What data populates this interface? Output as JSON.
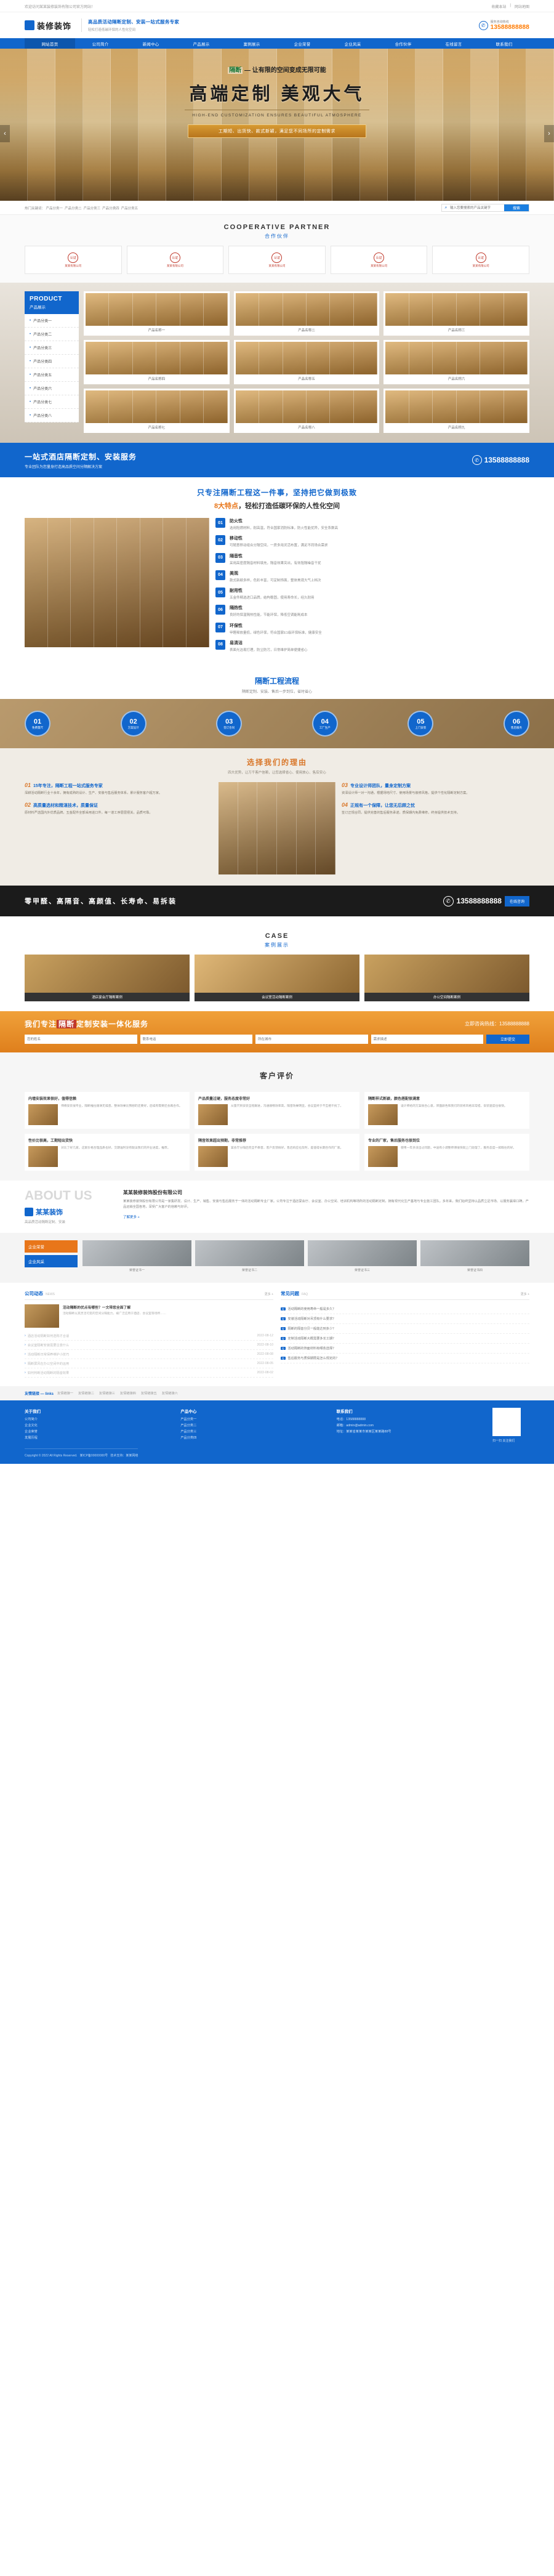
{
  "topbar": {
    "welcome": "欢迎访问某某装修装饰有限公司官方网站！",
    "links": [
      "收藏本站",
      "网站地图"
    ]
  },
  "header": {
    "logo_text": "装修装饰",
    "slogan_main": "高品质活动隔断定制、安装一站式服务专家",
    "slogan_sub": "轻松打造低碳环保的人性化空间",
    "phone_label": "服务咨询热线",
    "phone_number": "13588888888"
  },
  "nav": [
    {
      "label": "网站首页",
      "active": true
    },
    {
      "label": "公司简介",
      "active": false
    },
    {
      "label": "新闻中心",
      "active": false
    },
    {
      "label": "产品展示",
      "active": false
    },
    {
      "label": "案例展示",
      "active": false
    },
    {
      "label": "企业荣誉",
      "active": false
    },
    {
      "label": "企业风采",
      "active": false
    },
    {
      "label": "合作伙伴",
      "active": false
    },
    {
      "label": "在线留言",
      "active": false
    },
    {
      "label": "联系我们",
      "active": false
    }
  ],
  "banner": {
    "kicker_badge": "隔断",
    "kicker_text": "— 让有限的空间变成无限可能",
    "title": "高端定制  美观大气",
    "english": "HIGH-END CUSTOMIZATION ENSURES BEAUTIFUL ATMOSPHERE",
    "tags": "工期短、出货快、款式新颖，满足您不同场所的定制需求",
    "prev": "‹",
    "next": "›"
  },
  "search": {
    "hot_label": "热门关键词：",
    "hot_words": [
      "产品分类一",
      "产品分类二",
      "产品分类三",
      "产品分类四",
      "产品分类五"
    ],
    "placeholder": "输入您要搜索的产品关键字",
    "button": "搜索"
  },
  "partners": {
    "en": "COOPERATIVE PARTNER",
    "cn": "合作伙伴",
    "items": [
      {
        "name": "某某有限公司"
      },
      {
        "name": "某某有限公司"
      },
      {
        "name": "某某有限公司"
      },
      {
        "name": "某某有限公司"
      },
      {
        "name": "某某有限公司"
      }
    ]
  },
  "product": {
    "side_en": "PRODUCT",
    "side_cn": "产品展示",
    "categories": [
      "产品分类一",
      "产品分类二",
      "产品分类三",
      "产品分类四",
      "产品分类五",
      "产品分类六",
      "产品分类七",
      "产品分类八"
    ],
    "items": [
      {
        "name": "产品名称一"
      },
      {
        "name": "产品名称二"
      },
      {
        "name": "产品名称三"
      },
      {
        "name": "产品名称四"
      },
      {
        "name": "产品名称五"
      },
      {
        "name": "产品名称六"
      },
      {
        "name": "产品名称七"
      },
      {
        "name": "产品名称八"
      },
      {
        "name": "产品名称九"
      }
    ]
  },
  "cta_blue": {
    "title": "一站式酒店隔断定制、安装服务",
    "sub": "专业团队为您量身打造高品质空间分隔解决方案",
    "phone": "13588888888"
  },
  "features": {
    "h1": "只专注隔断工程这一件事，坚持把它做到极致",
    "h2_pre": "8大特点",
    "h2_post": "，轻松打造低碳环保的人性化空间",
    "items": [
      {
        "no": "01",
        "title": "防火性",
        "desc": "选用阻燃材料，耐高温，符合国家消防标准，防火性能优异，安全系数高"
      },
      {
        "no": "02",
        "title": "移动性",
        "desc": "可随意移动组合分隔空间，一房多用灵活布置，满足不同场合需求"
      },
      {
        "no": "03",
        "title": "隔音性",
        "desc": "采用高密度隔音材料填充，隔音效果突出，有效阻隔噪音干扰"
      },
      {
        "no": "04",
        "title": "美观",
        "desc": "款式新颖多样，色彩丰富，可定制饰面，整体美观大气上档次"
      },
      {
        "no": "05",
        "title": "耐用性",
        "desc": "五金件精选进口品牌，结构稳固，使用寿命长，经久耐用"
      },
      {
        "no": "06",
        "title": "隔热性",
        "desc": "良好的保温隔热性能，节能环保，降低空调能耗成本"
      },
      {
        "no": "07",
        "title": "环保性",
        "desc": "甲醛释放量低，绿色环保，符合国家E1级环保标准，健康安全"
      },
      {
        "no": "08",
        "title": "易清洁",
        "desc": "表面光洁易打理，防尘防污，日常维护简单便捷省心"
      }
    ]
  },
  "process": {
    "cn": "隔断工程流程",
    "sub": "隔断定制、安装、售后一步到位，省时省心",
    "steps": [
      {
        "no": "01",
        "label": "免费量尺"
      },
      {
        "no": "02",
        "label": "方案设计"
      },
      {
        "no": "03",
        "label": "签订合同"
      },
      {
        "no": "04",
        "label": "工厂生产"
      },
      {
        "no": "05",
        "label": "上门安装"
      },
      {
        "no": "06",
        "label": "售后服务"
      }
    ]
  },
  "why": {
    "cn": "选择我们的理由",
    "sub": "四大优势，让万千客户信赖，让您选择省心、使用放心、售后安心",
    "items": [
      {
        "no": "01",
        "title": "15年专注，隔断工程一站式服务专家",
        "desc": "深耕活动隔断行业十余年，拥有成熟的设计、生产、安装与售后服务体系，累计服务客户超万家。"
      },
      {
        "no": "02",
        "title": "高质量选材和精湛技术，质量保证",
        "desc": "原材料严选国内外优质品牌，五金配件全部采用进口件，每一道工序层层把关，品质可靠。"
      },
      {
        "no": "03",
        "title": "专业设计师团队，量身定制方案",
        "desc": "资深设计师一对一沟通，根据场地尺寸、使用场景与装修风格，提供个性化隔断定制方案。"
      },
      {
        "no": "04",
        "title": "正规有一个保障，让您无后顾之忧",
        "desc": "签订正规合同，提供完善的售后服务承诺，质保期内免费维修，终身提供技术支持。"
      }
    ]
  },
  "cta_dark": {
    "words": "零甲醛、高隔音、高颜值、长寿命、易拆装",
    "phone": "13588888888",
    "button": "在线咨询"
  },
  "case": {
    "en": "CASE",
    "cn": "案例展示",
    "items": [
      {
        "caption": "酒店宴会厅隔断案例"
      },
      {
        "caption": "会议室活动隔断案例"
      },
      {
        "caption": "办公空间隔断案例"
      }
    ]
  },
  "cta_orange": {
    "title_pre": "我们专注",
    "title_badge": "隔断",
    "title_post": "定制安装一体化服务",
    "phone_label": "立即咨询热线：",
    "phone": "13588888888",
    "fields": [
      {
        "placeholder": "您的姓名"
      },
      {
        "placeholder": "联系电话"
      },
      {
        "placeholder": "所在城市"
      },
      {
        "placeholder": "需求描述"
      }
    ],
    "submit": "立即提交"
  },
  "reviews": {
    "title": "客户评价",
    "items": [
      {
        "title": "内墙安装效果很好，值得信赖",
        "desc": "师傅安装很专业，隔断推拉顺滑无噪音，整体效果比预想的还要好，后续有需要还会再合作。"
      },
      {
        "title": "产品质量过硬，服务态度非常好",
        "desc": "从量尺到安装全程跟进，沟通顺畅效率高，隔音效果明显，会议室终于不互相干扰了。"
      },
      {
        "title": "隔断样式新颖，颜色搭配很满意",
        "desc": "设计师给的方案很合心意，饰面颜色和我们的装修风格非常搭，安装速度也很快。"
      },
      {
        "title": "性价比很高，工期短出货快",
        "desc": "对比了好几家，这家价格合理品质也好，交期准时没有耽误我们的开业进度，推荐。"
      },
      {
        "title": "隔音效果超出预期，非常推荐",
        "desc": "宴会厅分隔后完全不串音，客户反馈很好，售后响应也及时，是值得长期合作的厂家。"
      },
      {
        "title": "专业的厂家，售后服务也很到位",
        "desc": "使用一年多没出过问题，中途有小调整师傅很快就上门处理了，服务态度一如既往的好。"
      }
    ]
  },
  "about": {
    "big_en": "ABOUT US",
    "logo_name": "某某装饰",
    "logo_sub": "高品质活动隔断定制、安装",
    "heading": "某某装修装饰股份有限公司",
    "body": "某某装修装饰股份有限公司是一家集研发、设计、生产、销售、安装与售后服务于一体的活动隔断专业厂家。公司专注于酒店宴会厅、会议室、办公空间、培训机构等场所的活动隔断定制，拥有现代化生产基地与专业施工团队。多年来，我们始终坚持以品质立足市场、以服务赢得口碑，产品远销全国各地，深受广大客户的信赖与好评。",
    "more": "了解更多 +"
  },
  "showcase": {
    "tabs": [
      {
        "label": "企业荣誉"
      },
      {
        "label": "企业风采"
      }
    ],
    "items": [
      {
        "caption": "荣誉证书一"
      },
      {
        "caption": "荣誉证书二"
      },
      {
        "caption": "荣誉证书三"
      },
      {
        "caption": "荣誉证书四"
      }
    ]
  },
  "news": {
    "left": {
      "cn": "公司动态",
      "en": "NEWS",
      "more": "更多 +",
      "feature": {
        "title": "活动隔断的优点有哪些？一文带您全面了解",
        "desc": "活动隔断以其灵活可变的空间分隔能力，被广泛应用于酒店、会议室等场所……"
      },
      "list": [
        {
          "title": "酒店活动隔断如何选购才合适",
          "date": "2022-08-12"
        },
        {
          "title": "会议室隔断安装需要注意什么",
          "date": "2022-08-10"
        },
        {
          "title": "活动隔断日常保养维护小技巧",
          "date": "2022-08-08"
        },
        {
          "title": "隔断屏风在办公空间中的运用",
          "date": "2022-08-05"
        },
        {
          "title": "如何判断活动隔断的隔音效果",
          "date": "2022-08-02"
        }
      ]
    },
    "right": {
      "cn": "常见问题",
      "en": "FAQ",
      "more": "更多 +",
      "list": [
        "活动隔断的使用寿命一般是多久？",
        "安装活动隔断对吊顶有什么要求？",
        "隔断的隔音分贝一般能达到多少？",
        "定制活动隔断大概需要多长工期？",
        "活动隔断的饰面材料有哪些选择？",
        "售后服务与质保期限是怎么规定的？"
      ]
    }
  },
  "links": {
    "label": "友情链接 — links",
    "items": [
      "友情链接一",
      "友情链接二",
      "友情链接三",
      "友情链接四",
      "友情链接五",
      "友情链接六"
    ]
  },
  "footer": {
    "cols": [
      {
        "heading": "关于我们",
        "lines": [
          "公司简介",
          "企业文化",
          "企业荣誉",
          "发展历程"
        ]
      },
      {
        "heading": "产品中心",
        "lines": [
          "产品分类一",
          "产品分类二",
          "产品分类三",
          "产品分类四"
        ]
      },
      {
        "heading": "联系我们",
        "lines": [
          "电话：13588888888",
          "邮箱：admin@admin.com",
          "地址：某某省某某市某某区某某路88号"
        ]
      }
    ],
    "qr_label": "扫一扫 关注我们",
    "copyright": "Copyright © 2022 All Rights Reserved.",
    "icp": "某ICP备00000000号",
    "support": "技术支持：某某网络"
  }
}
